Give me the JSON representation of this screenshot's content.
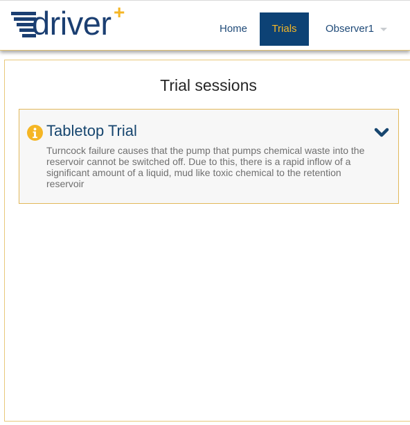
{
  "header": {
    "logo_text": "driver",
    "logo_plus": "+",
    "nav": {
      "home": "Home",
      "trials": "Trials",
      "observer": "Observer1"
    }
  },
  "main": {
    "title": "Trial sessions",
    "trial": {
      "name": "Tabletop Trial",
      "description": "Turncock failure causes that the pump that pumps chemical waste into the reservoir cannot be switched off. Due to this, there is a rapid inflow of a significant amount of a liquid, mud like toxic chemical to the retention reservoir"
    }
  },
  "colors": {
    "brand_navy": "#1b3f72",
    "accent_gold": "#f5b625",
    "active_tab_bg": "#0d4275"
  },
  "icons": {
    "logo_mark": "speed-lines-icon",
    "info": "info-circle-icon",
    "expand": "chevron-down-icon",
    "dropdown": "caret-down-icon"
  }
}
